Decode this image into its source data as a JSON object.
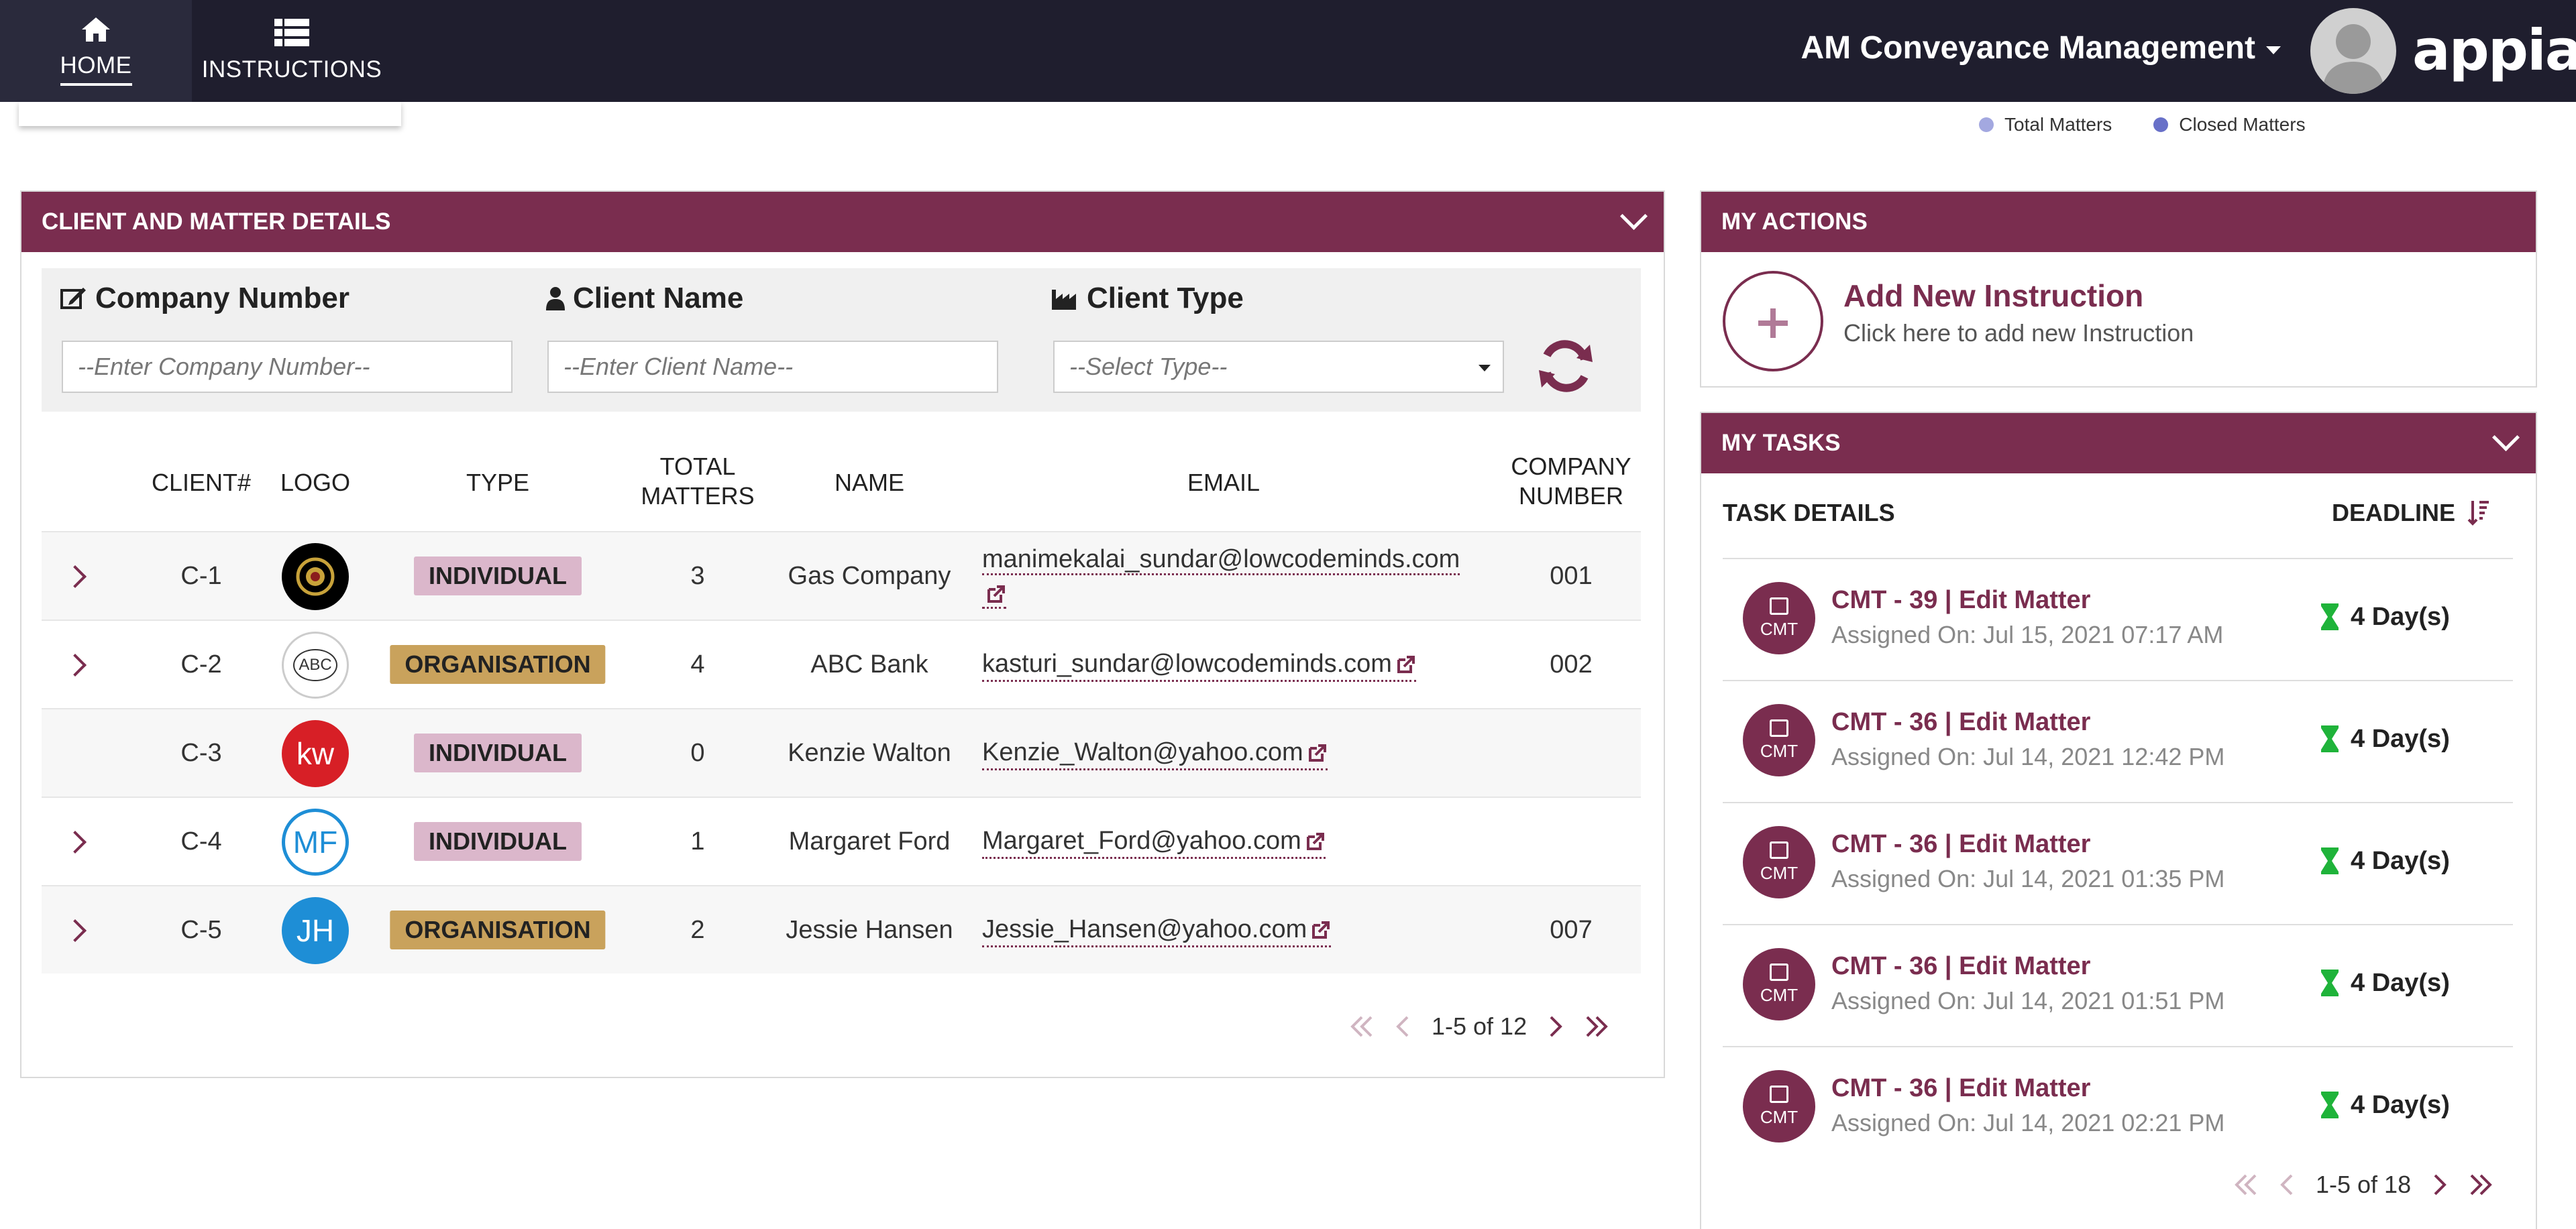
{
  "nav": {
    "home_label": "HOME",
    "instructions_label": "INSTRUCTIONS"
  },
  "header": {
    "app_name": "AM Conveyance Management",
    "brand": "appian"
  },
  "legend": {
    "items": [
      {
        "label": "Total Matters",
        "color": "#a3a8e0"
      },
      {
        "label": "Closed Matters",
        "color": "#6870c8"
      }
    ]
  },
  "client_panel": {
    "title": "CLIENT AND MATTER DETAILS",
    "filters": {
      "company_number_label": "Company Number",
      "company_number_placeholder": "--Enter Company Number--",
      "client_name_label": "Client Name",
      "client_name_placeholder": "--Enter Client Name--",
      "client_type_label": "Client Type",
      "client_type_placeholder": "--Select Type--"
    },
    "columns": {
      "client": "CLIENT#",
      "logo": "LOGO",
      "type": "TYPE",
      "total_matters_1": "TOTAL",
      "total_matters_2": "MATTERS",
      "name": "NAME",
      "email": "EMAIL",
      "company_number_1": "COMPANY",
      "company_number_2": "NUMBER"
    },
    "rows": [
      {
        "id": "C-1",
        "logo_text": "",
        "type": "INDIVIDUAL",
        "total": "3",
        "name": "Gas Company",
        "email": "manimekalai_sundar@lowcodeminds.com",
        "company": "001"
      },
      {
        "id": "C-2",
        "logo_text": "ABC",
        "type": "ORGANISATION",
        "total": "4",
        "name": "ABC Bank",
        "email": "kasturi_sundar@lowcodeminds.com",
        "company": "002"
      },
      {
        "id": "C-3",
        "logo_text": "kw",
        "type": "INDIVIDUAL",
        "total": "0",
        "name": "Kenzie Walton",
        "email": "Kenzie_Walton@yahoo.com",
        "company": ""
      },
      {
        "id": "C-4",
        "logo_text": "MF",
        "type": "INDIVIDUAL",
        "total": "1",
        "name": "Margaret Ford",
        "email": "Margaret_Ford@yahoo.com",
        "company": ""
      },
      {
        "id": "C-5",
        "logo_text": "JH",
        "type": "ORGANISATION",
        "total": "2",
        "name": "Jessie Hansen",
        "email": "Jessie_Hansen@yahoo.com",
        "company": "007"
      }
    ],
    "pager": "1-5 of 12"
  },
  "actions_panel": {
    "title": "MY ACTIONS",
    "add_title": "Add New Instruction",
    "add_sub": "Click here to add new Instruction"
  },
  "tasks_panel": {
    "title": "MY TASKS",
    "col_details": "TASK DETAILS",
    "col_deadline": "DEADLINE",
    "tasks": [
      {
        "code": "CMT",
        "title": "CMT - 39 | Edit Matter",
        "assigned": "Assigned On: Jul 15, 2021 07:17 AM",
        "deadline": "4 Day(s)"
      },
      {
        "code": "CMT",
        "title": "CMT - 36 | Edit Matter",
        "assigned": "Assigned On: Jul 14, 2021 12:42 PM",
        "deadline": "4 Day(s)"
      },
      {
        "code": "CMT",
        "title": "CMT - 36 | Edit Matter",
        "assigned": "Assigned On: Jul 14, 2021 01:35 PM",
        "deadline": "4 Day(s)"
      },
      {
        "code": "CMT",
        "title": "CMT - 36 | Edit Matter",
        "assigned": "Assigned On: Jul 14, 2021 01:51 PM",
        "deadline": "4 Day(s)"
      },
      {
        "code": "CMT",
        "title": "CMT - 36 | Edit Matter",
        "assigned": "Assigned On: Jul 14, 2021 02:21 PM",
        "deadline": "4 Day(s)"
      }
    ],
    "pager": "1-5 of 18"
  }
}
